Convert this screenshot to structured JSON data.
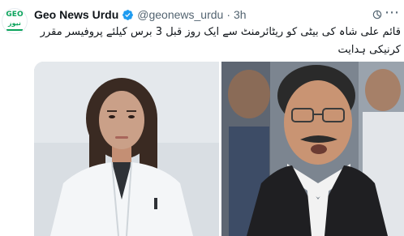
{
  "account": {
    "name": "Geo News Urdu",
    "handle": "@geonews_urdu",
    "separator": "·",
    "time": "3h",
    "avatar_logo": "GEO",
    "avatar_sub": "نیوز"
  },
  "tweet": {
    "text": "قائم علی شاہ کی بیٹی کو ریٹائرمنٹ سے ایک روز قبل 3 برس کیلئے پروفیسر مقرر کرنیکی ہدایت"
  },
  "icons": {
    "verified": "verified-badge-icon",
    "topic": "topic-icon",
    "more": "more-options-icon"
  },
  "colors": {
    "verified_blue": "#1d9bf0",
    "muted_text": "#536471",
    "brand_green": "#0aa35b"
  }
}
